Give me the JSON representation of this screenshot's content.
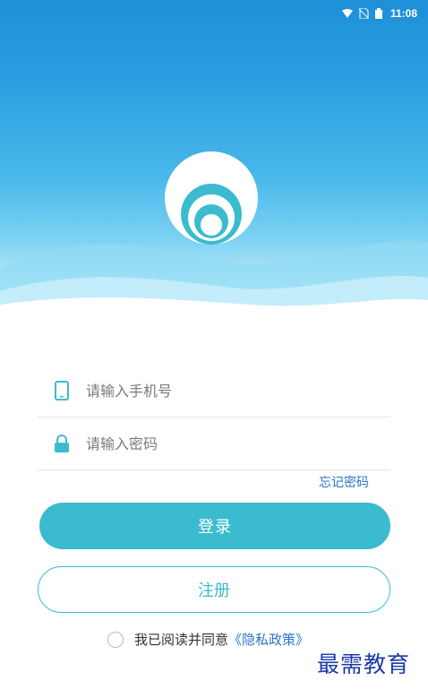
{
  "status_bar": {
    "time": "11:08",
    "icons": [
      "wifi-icon",
      "no-sim-icon",
      "battery-icon"
    ]
  },
  "login": {
    "phone_placeholder": "请输入手机号",
    "password_placeholder": "请输入密码",
    "forgot_password": "忘记密码",
    "login_button": "登录",
    "register_button": "注册",
    "agree_text": "我已阅读并同意",
    "policy_link": "《隐私政策》",
    "agreement_checked": false
  },
  "watermark": "最需教育",
  "colors": {
    "accent": "#3bbcce",
    "link": "#2a76c6",
    "header_top": "#1f8fd8",
    "header_bottom": "#7fd3f2"
  }
}
